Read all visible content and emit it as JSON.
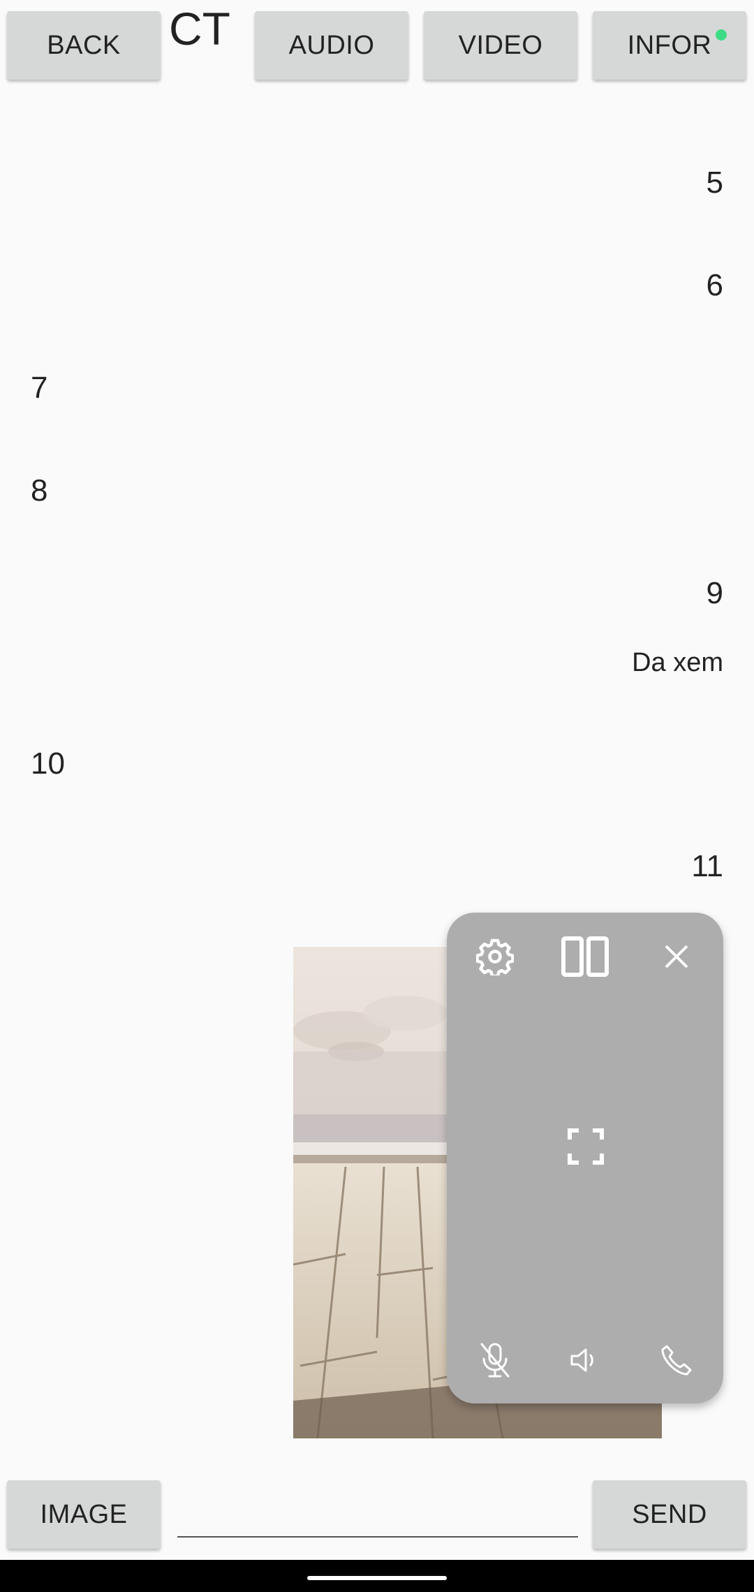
{
  "header": {
    "back_label": "BACK",
    "title": "CT",
    "audio_label": "AUDIO",
    "video_label": "VIDEO",
    "infor_label": "INFOR",
    "status_dot_color": "#3ddc84"
  },
  "messages": [
    {
      "text": "5",
      "side": "right"
    },
    {
      "text": "6",
      "side": "right"
    },
    {
      "text": "7",
      "side": "left"
    },
    {
      "text": "8",
      "side": "left"
    },
    {
      "text": "9",
      "side": "right"
    },
    {
      "text": "Da xem",
      "side": "right"
    },
    {
      "text": "10",
      "side": "left"
    },
    {
      "text": "11",
      "side": "right"
    }
  ],
  "call_overlay": {
    "icons": [
      "gear-icon",
      "split-view-icon",
      "close-icon",
      "fullscreen-icon",
      "mic-off-icon",
      "speaker-icon",
      "phone-icon"
    ]
  },
  "footer": {
    "image_label": "IMAGE",
    "send_label": "SEND",
    "message_value": "",
    "message_placeholder": ""
  }
}
